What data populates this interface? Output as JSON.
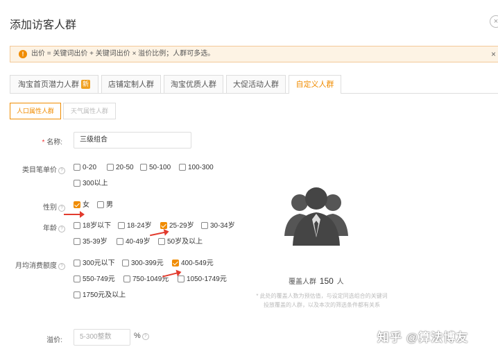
{
  "dialog": {
    "title": "添加访客人群",
    "close": "×"
  },
  "alert": {
    "icon": "!",
    "text": "出价 = 关键词出价 + 关键词出价 × 溢价比例；人群可多选。",
    "close": "×"
  },
  "tabs": [
    {
      "label": "淘宝首页潜力人群",
      "badge": "新"
    },
    {
      "label": "店铺定制人群"
    },
    {
      "label": "淘宝优质人群"
    },
    {
      "label": "大促活动人群"
    },
    {
      "label": "自定义人群",
      "active": true
    }
  ],
  "subtabs": [
    {
      "label": "人口属性人群",
      "active": true
    },
    {
      "label": "天气属性人群"
    }
  ],
  "form": {
    "name": {
      "label": "名称:",
      "required": "*",
      "value": "三级组合"
    },
    "price": {
      "label": "类目笔单价",
      "options": [
        {
          "label": "0-20",
          "checked": false
        },
        {
          "label": "20-50",
          "checked": false
        },
        {
          "label": "50-100",
          "checked": false
        },
        {
          "label": "100-300",
          "checked": false
        },
        {
          "label": "300以上",
          "checked": false
        }
      ]
    },
    "gender": {
      "label": "性别",
      "options": [
        {
          "label": "女",
          "checked": true
        },
        {
          "label": "男",
          "checked": false
        }
      ]
    },
    "age": {
      "label": "年龄",
      "options": [
        {
          "label": "18岁以下",
          "checked": false
        },
        {
          "label": "18-24岁",
          "checked": false
        },
        {
          "label": "25-29岁",
          "checked": true
        },
        {
          "label": "30-34岁",
          "checked": false
        },
        {
          "label": "35-39岁",
          "checked": false
        },
        {
          "label": "40-49岁",
          "checked": false
        },
        {
          "label": "50岁及以上",
          "checked": false
        }
      ]
    },
    "spend": {
      "label": "月均消费额度",
      "options": [
        {
          "label": "300元以下",
          "checked": false
        },
        {
          "label": "300-399元",
          "checked": false
        },
        {
          "label": "400-549元",
          "checked": true
        },
        {
          "label": "550-749元",
          "checked": false
        },
        {
          "label": "750-1049元",
          "checked": false
        },
        {
          "label": "1050-1749元",
          "checked": false
        },
        {
          "label": "1750元及以上",
          "checked": false
        }
      ]
    },
    "premium": {
      "label": "溢价:",
      "placeholder": "5-300整数",
      "unit": "%"
    }
  },
  "coverage": {
    "prefix": "覆盖人群",
    "count": "150",
    "suffix": "人"
  },
  "note": "* 此处的覆盖人数为预估值，与设定同选组合的关键词投放覆盖的人群，以及本次的筛选条件都有关系",
  "watermark": "知乎 @算法博友",
  "colors": {
    "accent": "#f08c00",
    "arrow": "#e23b2e",
    "alert_bg": "#fdf3e4"
  },
  "icons": {
    "illustration": "people-group-icon",
    "help": "question-circle-icon"
  }
}
